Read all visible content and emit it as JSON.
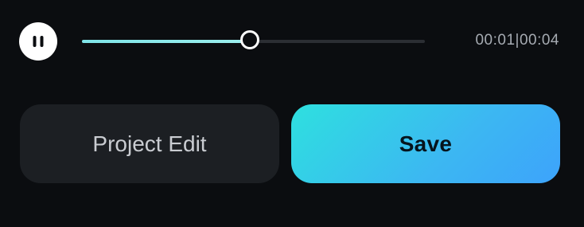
{
  "player": {
    "state_icon": "pause-icon",
    "progress_fraction": 0.49,
    "elapsed": "00:01",
    "separator": "|",
    "duration": "00:04",
    "time_text": "00:01|00:04"
  },
  "actions": {
    "project_edit_label": "Project Edit",
    "save_label": "Save"
  },
  "colors": {
    "background": "#0b0d10",
    "track": "#2b2e33",
    "progress_fill": "#8ae9eb",
    "secondary_button": "#1c1f23",
    "primary_gradient_start": "#2ee0df",
    "primary_gradient_end": "#3da3fb"
  }
}
